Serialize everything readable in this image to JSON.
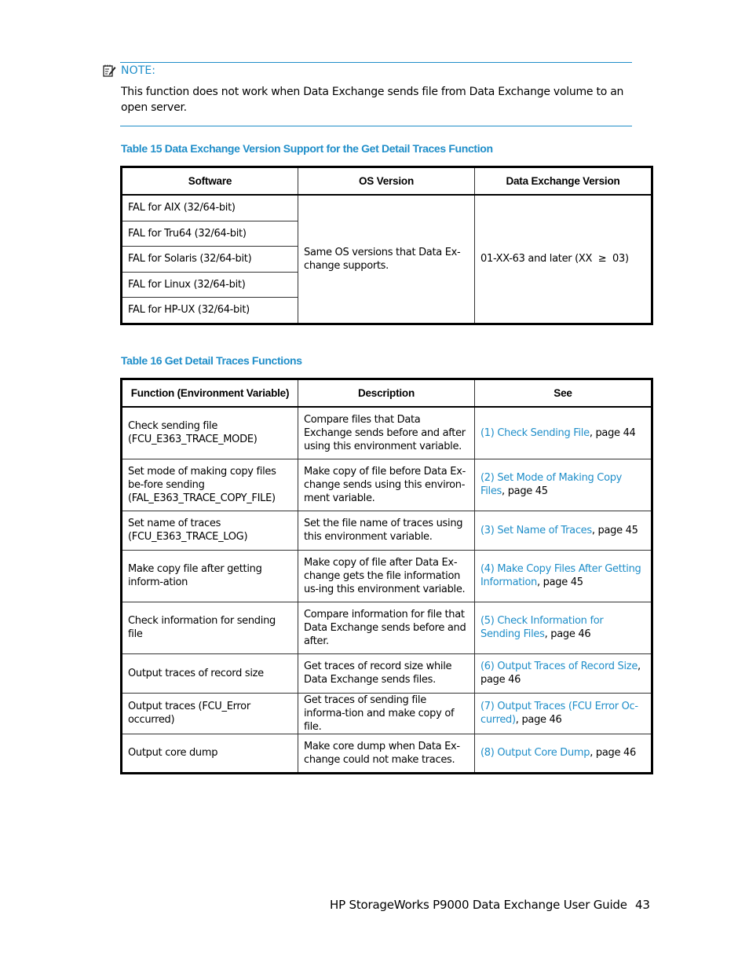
{
  "note": {
    "icon": "note-pencil-icon",
    "label": "NOTE:",
    "text": "This function does not work when Data Exchange sends file from Data Exchange volume to an open server."
  },
  "table15": {
    "caption": "Table 15 Data Exchange Version Support for the Get Detail Traces Function",
    "headers": [
      "Software",
      "OS Version",
      "Data Exchange Version"
    ],
    "software": [
      "FAL for AIX (32/64-bit)",
      "FAL for Tru64 (32/64-bit)",
      "FAL for Solaris (32/64-bit)",
      "FAL for Linux (32/64-bit)",
      "FAL for HP-UX (32/64-bit)"
    ],
    "os_version": "Same OS versions that Data Ex-change supports.",
    "dx_version": "01-XX-63 and later (XX  ≥  03)"
  },
  "table16": {
    "caption": "Table 16 Get Detail Traces Functions",
    "headers": [
      "Function (Environment Variable)",
      "Description",
      "See"
    ],
    "rows": [
      {
        "function": [
          "Check sending file",
          "(FCU_E363_TRACE_MODE)"
        ],
        "description": "Compare files that Data Exchange sends before and after using this environment variable.",
        "link": "(1) Check Sending File",
        "page": ", page 44"
      },
      {
        "function": [
          "Set mode of making copy files be-fore sending",
          "(FAL_E363_TRACE_COPY_FILE)"
        ],
        "description": "Make copy of file before Data Ex-change sends using this environ-ment variable.",
        "link": "(2) Set Mode of Making Copy Files",
        "page": ", page 45"
      },
      {
        "function": [
          "Set name of traces",
          "(FCU_E363_TRACE_LOG)"
        ],
        "description": "Set the file name of traces using this environment variable.",
        "link": "(3) Set Name of Traces",
        "page": ", page 45"
      },
      {
        "function": [
          "Make copy file after getting inform-ation",
          ""
        ],
        "description": "Make copy of file after Data Ex-change gets the file information us-ing this environment variable.",
        "link": "(4) Make Copy Files After Getting Information",
        "page": ", page 45"
      },
      {
        "function": [
          "Check information for sending file",
          ""
        ],
        "description": "Compare information for file that Data Exchange sends before and after.",
        "link": "(5) Check Information for Sending Files",
        "page": ", page 46"
      },
      {
        "function": [
          "Output traces of record size",
          ""
        ],
        "description": "Get traces of record size while Data Exchange sends files.",
        "link": "(6) Output Traces of Record Size",
        "page": ", page 46"
      },
      {
        "function": [
          "Output traces (FCU_Error occurred)",
          ""
        ],
        "description": "Get traces of sending file informa-tion and make copy of file.",
        "link": "(7) Output Traces (FCU Error Oc-curred)",
        "page": ", page 46"
      },
      {
        "function": [
          "Output core dump",
          ""
        ],
        "description": "Make core dump when Data Ex-change could not make traces.",
        "link": "(8) Output Core Dump",
        "page": ", page 46"
      }
    ]
  },
  "footer": {
    "title": "HP StorageWorks P9000 Data Exchange User Guide",
    "page_number": "43"
  },
  "colors": {
    "accent": "#1f8ec9",
    "text": "#000000"
  }
}
